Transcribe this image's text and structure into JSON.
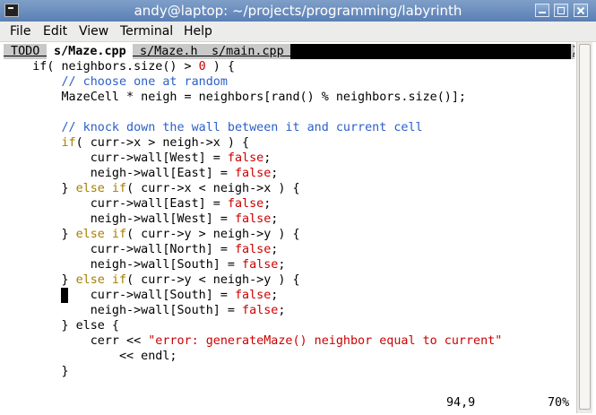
{
  "window": {
    "title": "andy@laptop: ~/projects/programming/labyrinth"
  },
  "menu": [
    "File",
    "Edit",
    "View",
    "Terminal",
    "Help"
  ],
  "tabline": {
    "tabs": [
      {
        "label": " TODO ",
        "selected": false
      },
      {
        "label": " s/Maze.cpp ",
        "selected": true
      },
      {
        "label": " s/Maze.h ",
        "selected": false
      },
      {
        "label": " s/main.cpp ",
        "selected": false
      }
    ],
    "close": "X"
  },
  "code": [
    [
      [
        "    if( neighbors.size() > ",
        ""
      ],
      [
        "0",
        "n"
      ],
      [
        " ) {",
        ""
      ]
    ],
    [
      [
        "        // choose one at random",
        "c"
      ]
    ],
    [
      [
        "        MazeCell * neigh = neighbors[rand() % neighbors.size()];",
        ""
      ]
    ],
    [
      [
        "",
        ""
      ]
    ],
    [
      [
        "        // knock down the wall between it and current cell",
        "c"
      ]
    ],
    [
      [
        "        ",
        ""
      ],
      [
        "if",
        "k"
      ],
      [
        "( curr->x > neigh->x ) {",
        ""
      ]
    ],
    [
      [
        "            curr->wall[West] = ",
        ""
      ],
      [
        "false",
        "n"
      ],
      [
        ";",
        ""
      ]
    ],
    [
      [
        "            neigh->wall[East] = ",
        ""
      ],
      [
        "false",
        "n"
      ],
      [
        ";",
        ""
      ]
    ],
    [
      [
        "        } ",
        ""
      ],
      [
        "else if",
        "k"
      ],
      [
        "( curr->x < neigh->x ) {",
        ""
      ]
    ],
    [
      [
        "            curr->wall[East] = ",
        ""
      ],
      [
        "false",
        "n"
      ],
      [
        ";",
        ""
      ]
    ],
    [
      [
        "            neigh->wall[West] = ",
        ""
      ],
      [
        "false",
        "n"
      ],
      [
        ";",
        ""
      ]
    ],
    [
      [
        "        } ",
        ""
      ],
      [
        "else if",
        "k"
      ],
      [
        "( curr->y > neigh->y ) {",
        ""
      ]
    ],
    [
      [
        "            curr->wall[North] = ",
        ""
      ],
      [
        "false",
        "n"
      ],
      [
        ";",
        ""
      ]
    ],
    [
      [
        "            neigh->wall[South] = ",
        ""
      ],
      [
        "false",
        "n"
      ],
      [
        ";",
        ""
      ]
    ],
    [
      [
        "        } ",
        ""
      ],
      [
        "else if",
        "k"
      ],
      [
        "( curr->y < neigh->y ) {",
        ""
      ]
    ],
    [
      [
        "            curr->wall[South] = ",
        ""
      ],
      [
        "false",
        "n"
      ],
      [
        ";",
        ""
      ]
    ],
    [
      [
        "            neigh->wall[South] = ",
        ""
      ],
      [
        "false",
        "n"
      ],
      [
        ";",
        ""
      ]
    ],
    [
      [
        "        } else {",
        ""
      ]
    ],
    [
      [
        "            cerr << ",
        ""
      ],
      [
        "\"error: generateMaze() neighbor equal to current\"",
        "s"
      ]
    ],
    [
      [
        "                << endl;",
        ""
      ]
    ],
    [
      [
        "        }",
        ""
      ]
    ]
  ],
  "status": {
    "position": "94,9",
    "percent": "70%"
  },
  "colors": {
    "comment": "#2a5fc8",
    "keyword": "#a67f00",
    "constant": "#cc0000",
    "titlebar": "#6b8fc0"
  }
}
